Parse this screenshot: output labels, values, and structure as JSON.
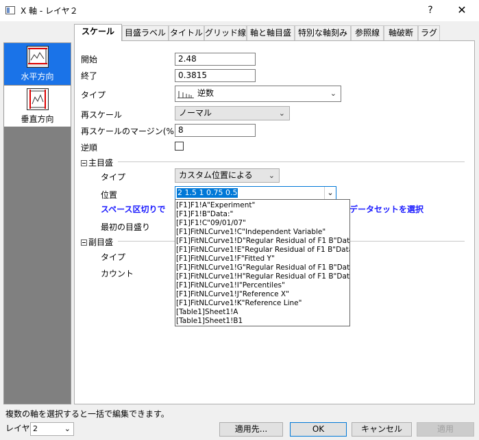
{
  "window": {
    "title": "X 軸 - レイヤ２",
    "help": "?",
    "close": "✕"
  },
  "left_panel": {
    "items": [
      {
        "label": "水平方向",
        "selected": true
      },
      {
        "label": "垂直方向",
        "selected": false
      }
    ]
  },
  "tabs": [
    {
      "label": "スケール",
      "active": true
    },
    {
      "label": "目盛ラベル"
    },
    {
      "label": "タイトル"
    },
    {
      "label": "グリッド線"
    },
    {
      "label": "軸と軸目盛"
    },
    {
      "label": "特別な軸刻み"
    },
    {
      "label": "参照線"
    },
    {
      "label": "軸破断"
    },
    {
      "label": "ラグ"
    }
  ],
  "scale": {
    "start_label": "開始",
    "start_value": "2.48",
    "end_label": "終了",
    "end_value": "0.3815",
    "type_label": "タイプ",
    "type_value": "逆数",
    "rescale_label": "再スケール",
    "rescale_value": "ノーマル",
    "margin_label": "再スケールのマージン(%)",
    "margin_value": "8",
    "reverse_label": "逆順"
  },
  "major": {
    "section_label": "主目盛",
    "type_label": "タイプ",
    "type_value": "カスタム位置による",
    "position_label": "位置",
    "position_value": "2 1.5 1 0.75 0.5",
    "hint": "スペース区切りで",
    "hint_right": "データセットを選択",
    "first_tick_label": "最初の目盛り"
  },
  "minor": {
    "section_label": "副目盛",
    "type_label": "タイプ",
    "count_label": "カウント"
  },
  "dropdown_items": [
    "[F1]F1!A\"Experiment\"",
    "[F1]F1!B\"Data:\"",
    "[F1]F1!C\"09/01/07\"",
    "[F1]FitNLCurve1!C\"Independent Variable\"",
    "[F1]FitNLCurve1!D\"Regular Residual of F1 B\"Data:\"\"",
    "[F1]FitNLCurve1!E\"Regular Residual of F1 B\"Data:\"\"",
    "[F1]FitNLCurve1!F\"Fitted Y\"",
    "[F1]FitNLCurve1!G\"Regular Residual of F1 B\"Data:\"\"",
    "[F1]FitNLCurve1!H\"Regular Residual of F1 B\"Data:\"\"",
    "[F1]FitNLCurve1!I\"Percentiles\"",
    "[F1]FitNLCurve1!J\"Reference X\"",
    "[F1]FitNLCurve1!K\"Reference Line\"",
    "[Table1]Sheet1!A",
    "[Table1]Sheet1!B1"
  ],
  "footer": {
    "status": "複数の軸を選択すると一括で編集できます。",
    "layer_label": "レイヤ",
    "layer_value": "2",
    "apply_to": "適用先...",
    "ok": "OK",
    "cancel": "キャンセル",
    "apply": "適用"
  },
  "colors": {
    "selected": "#1a73e8",
    "hint": "#1a1aff",
    "focus": "#0078d7"
  }
}
